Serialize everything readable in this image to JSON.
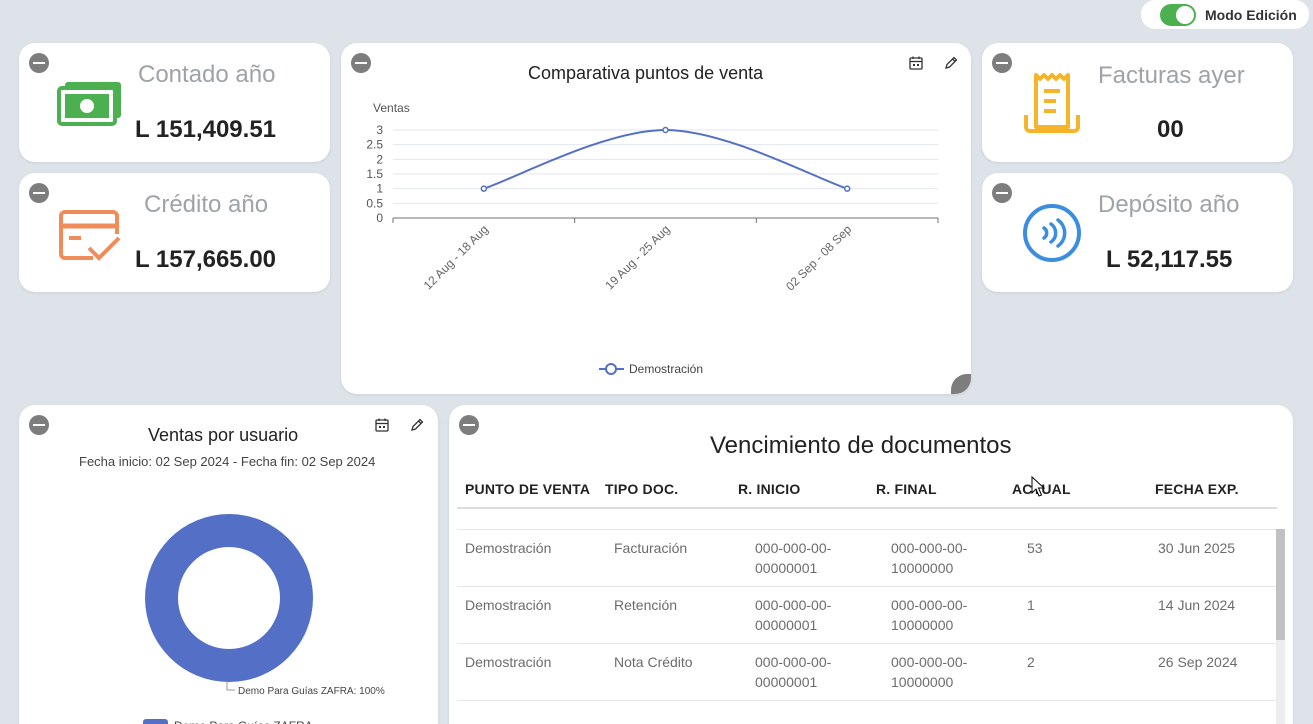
{
  "mode": {
    "label": "Modo Edición",
    "enabled": true,
    "accent": "#4caf50"
  },
  "kpis": {
    "contado": {
      "title": "Contado año",
      "value": "L 151,409.51",
      "icon": "money-icon",
      "color": "#4caf50"
    },
    "credito": {
      "title": "Crédito año",
      "value": "L 157,665.00",
      "icon": "credit-card-check-icon",
      "color": "#f08c5a"
    },
    "facturas": {
      "title": "Facturas ayer",
      "value": "00",
      "icon": "receipt-icon",
      "color": "#f6b42b"
    },
    "deposito": {
      "title": "Depósito año",
      "value": "L 52,117.55",
      "icon": "contactless-icon",
      "color": "#3b8de0"
    }
  },
  "line_chart": {
    "title": "Comparativa puntos de venta",
    "legend": "Demostración",
    "ylabel": "Ventas",
    "color": "#5470c6"
  },
  "donut_chart": {
    "title": "Ventas por usuario",
    "subtitle": "Fecha inicio: 02 Sep 2024 - Fecha fin: 02 Sep 2024",
    "slice_label": "Demo Para Guías ZAFRA: 100%",
    "legend": "Demo Para Guías ZAFRA",
    "color": "#5470c6"
  },
  "chart_data": [
    {
      "type": "line",
      "title": "Comparativa puntos de venta",
      "ylabel": "Ventas",
      "categories": [
        "12 Aug - 18 Aug",
        "19 Aug - 25 Aug",
        "02 Sep - 08 Sep"
      ],
      "series": [
        {
          "name": "Demostración",
          "values": [
            1,
            3,
            1
          ]
        }
      ],
      "ylim": [
        0,
        3
      ],
      "yticks": [
        "0",
        "0.5",
        "1",
        "1.5",
        "2",
        "2.5",
        "3"
      ],
      "smooth": true,
      "grid": true,
      "legend_position": "bottom"
    },
    {
      "type": "pie",
      "title": "Ventas por usuario",
      "categories": [
        "Demo Para Guías ZAFRA"
      ],
      "values": [
        100
      ],
      "donut": true,
      "legend_position": "bottom"
    }
  ],
  "table": {
    "title": "Vencimiento de documentos",
    "headers": [
      "PUNTO DE VENTA",
      "TIPO DOC.",
      "R. INICIO",
      "R. FINAL",
      "ACTUAL",
      "FECHA EXP."
    ],
    "rows": [
      [
        "Demostración",
        "Facturación",
        "000-000-00-00000001",
        "000-000-00-10000000",
        "53",
        "30 Jun 2025"
      ],
      [
        "Demostración",
        "Retención",
        "000-000-00-00000001",
        "000-000-00-10000000",
        "1",
        "14 Jun 2024"
      ],
      [
        "Demostración",
        "Nota Crédito",
        "000-000-00-00000001",
        "000-000-00-10000000",
        "2",
        "26 Sep 2024"
      ]
    ]
  }
}
